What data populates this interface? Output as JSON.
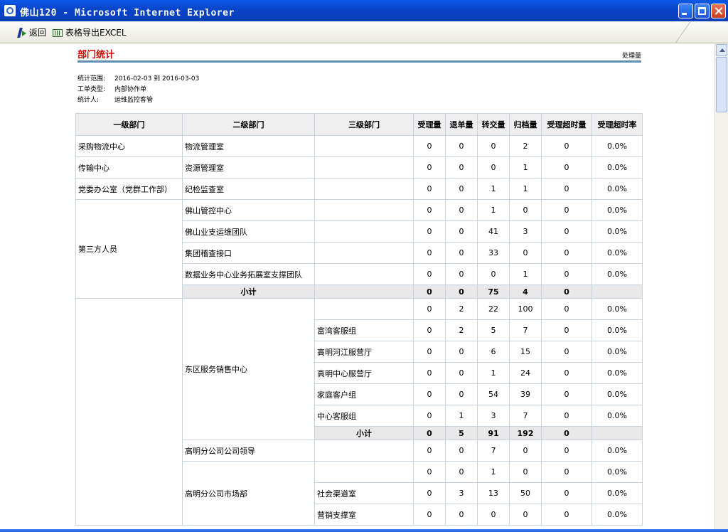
{
  "window": {
    "title": "佛山120 - Microsoft Internet Explorer"
  },
  "toolbar": {
    "back_label": "返回",
    "export_label": "表格导出EXCEL"
  },
  "page": {
    "title": "部门统计",
    "role": "处理量",
    "meta": [
      {
        "label": "统计范围:",
        "value": "2016-02-03  到  2016-03-03"
      },
      {
        "label": "工单类型:",
        "value": "  内部协作单"
      },
      {
        "label": "统计人:",
        "value": "  运维监控客管"
      }
    ]
  },
  "table": {
    "headers": [
      "一级部门",
      "二级部门",
      "三级部门",
      "受理量",
      "退单量",
      "转交量",
      "归档量",
      "受理超时量",
      "受理超时率"
    ],
    "subtotal_label": "小计",
    "rows": [
      {
        "l1": "采购物流中心",
        "l2": "物流管理室",
        "l3": "",
        "v": [
          "0",
          "0",
          "0",
          "2",
          "0",
          "0.0%"
        ]
      },
      {
        "l1": "传输中心",
        "l2": "资源管理室",
        "l3": "",
        "v": [
          "0",
          "0",
          "0",
          "1",
          "0",
          "0.0%"
        ]
      },
      {
        "l1": "党委办公室（党群工作部）",
        "l2": "纪检监查室",
        "l3": "",
        "v": [
          "0",
          "0",
          "1",
          "1",
          "0",
          "0.0%"
        ]
      },
      {
        "l1": "第三方人员",
        "l2": "佛山管控中心",
        "l3": "",
        "v": [
          "0",
          "0",
          "1",
          "0",
          "0",
          "0.0%"
        ]
      },
      {
        "l2": "佛山业支运维团队",
        "l3": "",
        "v": [
          "0",
          "0",
          "41",
          "3",
          "0",
          "0.0%"
        ]
      },
      {
        "l2": "集团稽查接口",
        "l3": "",
        "v": [
          "0",
          "0",
          "33",
          "0",
          "0",
          "0.0%"
        ]
      },
      {
        "l2": "数据业务中心业务拓展室支撑团队",
        "l3": "",
        "v": [
          "0",
          "0",
          "0",
          "1",
          "0",
          "0.0%"
        ]
      },
      {
        "subtotal": [
          "0",
          "0",
          "75",
          "4",
          "0",
          ""
        ]
      },
      {
        "l2": "东区服务销售中心",
        "l3": "",
        "v": [
          "0",
          "2",
          "22",
          "100",
          "0",
          "0.0%"
        ]
      },
      {
        "l3": "富湾客服组",
        "v": [
          "0",
          "2",
          "5",
          "7",
          "0",
          "0.0%"
        ]
      },
      {
        "l3": "高明河江服营厅",
        "v": [
          "0",
          "0",
          "6",
          "15",
          "0",
          "0.0%"
        ]
      },
      {
        "l3": "高明中心服营厅",
        "v": [
          "0",
          "0",
          "1",
          "24",
          "0",
          "0.0%"
        ]
      },
      {
        "l3": "家庭客户组",
        "v": [
          "0",
          "0",
          "54",
          "39",
          "0",
          "0.0%"
        ]
      },
      {
        "l3": "中心客服组",
        "v": [
          "0",
          "1",
          "3",
          "7",
          "0",
          "0.0%"
        ]
      },
      {
        "subtotal": [
          "0",
          "5",
          "91",
          "192",
          "0",
          ""
        ]
      },
      {
        "l2": "高明分公司公司领导",
        "l3": "",
        "v": [
          "0",
          "0",
          "7",
          "0",
          "0",
          "0.0%"
        ]
      },
      {
        "l2": "高明分公司市场部",
        "l3": "",
        "v": [
          "0",
          "0",
          "1",
          "0",
          "0",
          "0.0%"
        ]
      },
      {
        "l3": "社会渠道室",
        "v": [
          "0",
          "3",
          "13",
          "50",
          "0",
          "0.0%"
        ]
      },
      {
        "l3": "营销支撑室",
        "v": [
          "0",
          "0",
          "0",
          "0",
          "0",
          "0.0%"
        ]
      }
    ]
  }
}
